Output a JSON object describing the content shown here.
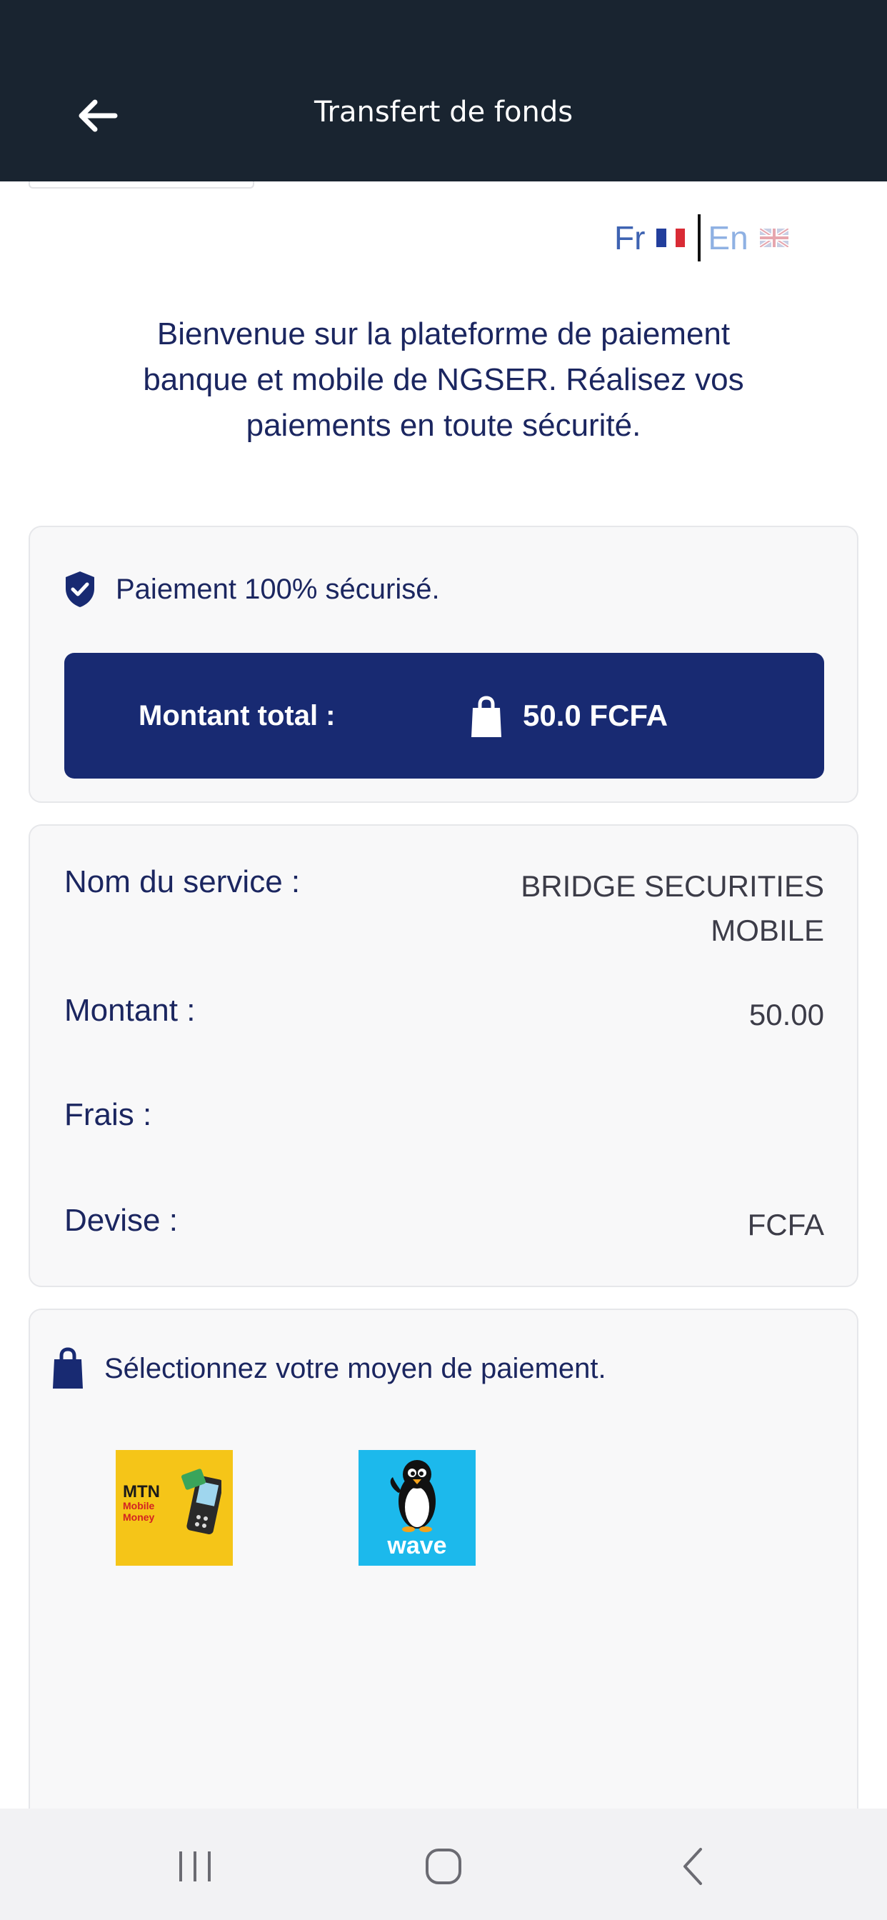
{
  "header": {
    "title": "Transfert de fonds",
    "back_icon": "arrow-left-icon",
    "background": "#192430"
  },
  "language": {
    "fr_label": "Fr",
    "en_label": "En",
    "fr_flag_icon": "flag-fr-icon",
    "en_flag_icon": "flag-uk-icon",
    "selected": "Fr"
  },
  "welcome": {
    "line1": "Bienvenue sur la plateforme de paiement",
    "line2": "banque et mobile de NGSER. Réalisez vos",
    "line3": "paiements en toute sécurité."
  },
  "secure": {
    "icon": "shield-check-icon",
    "text": "Paiement 100% sécurisé."
  },
  "total": {
    "label": "Montant total :",
    "bag_icon": "shopping-bag-icon",
    "value": "50.0 FCFA",
    "background": "#182a72"
  },
  "details": {
    "service_label": "Nom du service :",
    "service_value_line1": "BRIDGE SECURITIES",
    "service_value_line2": "MOBILE",
    "amount_label": "Montant :",
    "amount_value": "50.00",
    "fees_label": "Frais :",
    "fees_value": "",
    "currency_label": "Devise :",
    "currency_value": "FCFA"
  },
  "payment": {
    "icon": "shopping-bag-icon",
    "prompt": "Sélectionnez votre moyen de paiement.",
    "options": [
      {
        "name": "MTN Mobile Money",
        "logo_text": "MTN",
        "logo_sub1": "Mobile",
        "logo_sub2": "Money",
        "color": "#f5c518"
      },
      {
        "name": "Wave",
        "logo_text": "wave",
        "color": "#1cb9ec"
      }
    ]
  },
  "system_nav": {
    "recents_icon": "recents-icon",
    "home_icon": "home-icon",
    "back_icon": "chevron-left-icon"
  }
}
